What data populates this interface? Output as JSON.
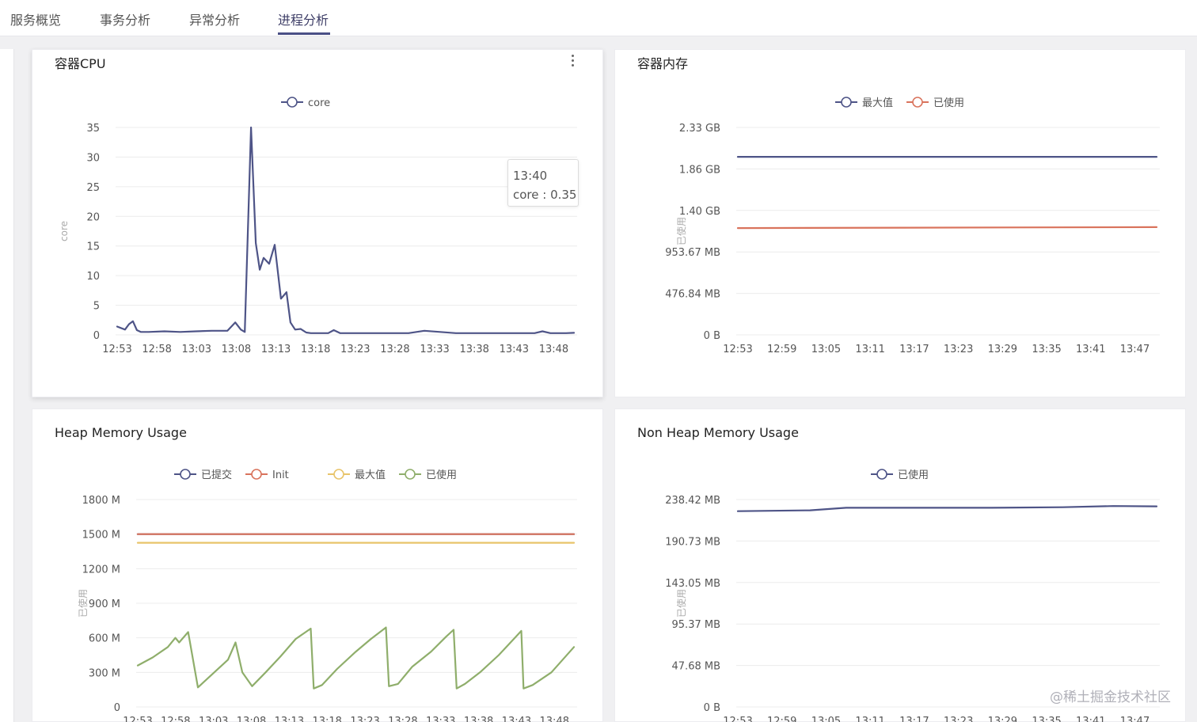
{
  "tabs": [
    {
      "label": "服务概览",
      "active": false
    },
    {
      "label": "事务分析",
      "active": false
    },
    {
      "label": "异常分析",
      "active": false
    },
    {
      "label": "进程分析",
      "active": true
    }
  ],
  "colors": {
    "navy": "#4e5487",
    "red": "#d9735c",
    "yellow": "#e8c46a",
    "green": "#8fae6b",
    "active_tab": "#4a4f85"
  },
  "panels": {
    "cpu": {
      "title": "容器CPU",
      "menu_icon": "more-vertical-icon"
    },
    "mem": {
      "title": "容器内存"
    },
    "heap": {
      "title": "Heap Memory Usage"
    },
    "nonheap": {
      "title": "Non Heap Memory Usage"
    }
  },
  "tooltip": {
    "time": "13:40",
    "text": "core : 0.35"
  },
  "watermark": "@稀土掘金技术社区",
  "chart_data": [
    {
      "id": "cpu",
      "type": "line",
      "ylabel": "core",
      "yticks": [
        "0",
        "5",
        "10",
        "15",
        "20",
        "25",
        "30",
        "35"
      ],
      "ylim": [
        0,
        35
      ],
      "xticks": [
        "12:53",
        "12:58",
        "13:03",
        "13:08",
        "13:13",
        "13:18",
        "13:23",
        "13:28",
        "13:33",
        "13:38",
        "13:43",
        "13:48"
      ],
      "xlim": [
        0,
        58
      ],
      "grid": true,
      "legend": "top-center",
      "series": [
        {
          "name": "core",
          "color": "#4e5487",
          "x": [
            0,
            1,
            1.5,
            2,
            2.5,
            3,
            4,
            6,
            8,
            10,
            12,
            14,
            15,
            15.7,
            16.2,
            17,
            17.6,
            18.1,
            18.6,
            19.3,
            20,
            20.8,
            21.5,
            22,
            22.6,
            23.3,
            24,
            24.6,
            25.2,
            25.8,
            26.3,
            26.8,
            27.5,
            28.3,
            29,
            31,
            33,
            34,
            35,
            37,
            39,
            43,
            44,
            45,
            47,
            51,
            53,
            54,
            55,
            57,
            58
          ],
          "y": [
            1.4,
            0.9,
            1.8,
            2.3,
            0.8,
            0.5,
            0.5,
            0.6,
            0.5,
            0.6,
            0.7,
            0.7,
            2.1,
            0.9,
            0.5,
            35,
            15.5,
            11,
            13,
            12,
            15.2,
            6.1,
            7.2,
            2.1,
            0.9,
            1.0,
            0.4,
            0.3,
            0.3,
            0.3,
            0.3,
            0.3,
            0.8,
            0.3,
            0.3,
            0.3,
            0.3,
            0.3,
            0.3,
            0.3,
            0.7,
            0.3,
            0.3,
            0.3,
            0.3,
            0.3,
            0.3,
            0.6,
            0.3,
            0.3,
            0.35
          ]
        }
      ]
    },
    {
      "id": "mem",
      "type": "line",
      "ylabel": "已使用",
      "yticks": [
        "0 B",
        "476.84 MB",
        "953.67 MB",
        "1.40 GB",
        "1.86 GB",
        "2.33 GB"
      ],
      "ylim": [
        0,
        2.33
      ],
      "xticks": [
        "12:53",
        "12:59",
        "13:05",
        "13:11",
        "13:17",
        "13:23",
        "13:29",
        "13:35",
        "13:41",
        "13:47"
      ],
      "xlim": [
        0,
        58
      ],
      "grid": true,
      "legend": "top-center",
      "series": [
        {
          "name": "最大值",
          "color": "#4e5487",
          "x": [
            0,
            58
          ],
          "y": [
            2.0,
            2.0
          ]
        },
        {
          "name": "已使用",
          "color": "#d9735c",
          "x": [
            0,
            58
          ],
          "y": [
            1.2,
            1.21
          ]
        }
      ]
    },
    {
      "id": "heap",
      "type": "line",
      "ylabel": "已使用",
      "yticks": [
        "0",
        "300 M",
        "600 M",
        "900 M",
        "1200 M",
        "1500 M",
        "1800 M"
      ],
      "ylim": [
        0,
        1800
      ],
      "xticks": [
        "12:53",
        "12:58",
        "13:03",
        "13:08",
        "13:13",
        "13:18",
        "13:23",
        "13:28",
        "13:33",
        "13:38",
        "13:43",
        "13:48"
      ],
      "xlim": [
        0,
        58
      ],
      "grid": true,
      "legend": "top-center",
      "series": [
        {
          "name": "已提交",
          "color": "#4e5487",
          "x": [
            0,
            58
          ],
          "y": [
            1500,
            1500
          ]
        },
        {
          "name": "Init",
          "color": "#d9735c",
          "x": [
            0,
            58
          ],
          "y": [
            1500,
            1500
          ]
        },
        {
          "name": "最大值",
          "color": "#e8c46a",
          "x": [
            0,
            58
          ],
          "y": [
            1425,
            1425
          ]
        },
        {
          "name": "已使用",
          "color": "#8fae6b",
          "x": [
            0,
            2,
            4,
            5,
            5.5,
            6.7,
            8,
            10,
            12,
            13,
            13.9,
            15.2,
            17,
            19,
            21,
            23,
            23.4,
            24.5,
            26.5,
            29,
            31,
            33,
            33.4,
            34.6,
            36.5,
            39,
            41,
            42,
            42.4,
            43.5,
            45.5,
            48,
            50,
            51,
            51.3,
            52.5,
            55,
            58
          ],
          "y": [
            360,
            430,
            520,
            600,
            560,
            650,
            170,
            290,
            410,
            560,
            300,
            180,
            300,
            440,
            590,
            680,
            160,
            190,
            330,
            480,
            590,
            690,
            180,
            200,
            350,
            480,
            610,
            670,
            160,
            200,
            300,
            450,
            590,
            660,
            160,
            190,
            300,
            520
          ]
        }
      ]
    },
    {
      "id": "nonheap",
      "type": "line",
      "ylabel": "已使用",
      "yticks": [
        "0 B",
        "47.68 MB",
        "95.37 MB",
        "143.05 MB",
        "190.73 MB",
        "238.42 MB"
      ],
      "ylim": [
        0,
        238.42
      ],
      "xticks": [
        "12:53",
        "12:59",
        "13:05",
        "13:11",
        "13:17",
        "13:23",
        "13:29",
        "13:35",
        "13:41",
        "13:47"
      ],
      "xlim": [
        0,
        58
      ],
      "grid": true,
      "legend": "top-center",
      "series": [
        {
          "name": "已使用",
          "color": "#4e5487",
          "x": [
            0,
            10,
            15,
            25,
            35,
            45,
            52,
            58
          ],
          "y": [
            225,
            226,
            229,
            229,
            229,
            229.6,
            231,
            230.6
          ]
        }
      ]
    }
  ]
}
